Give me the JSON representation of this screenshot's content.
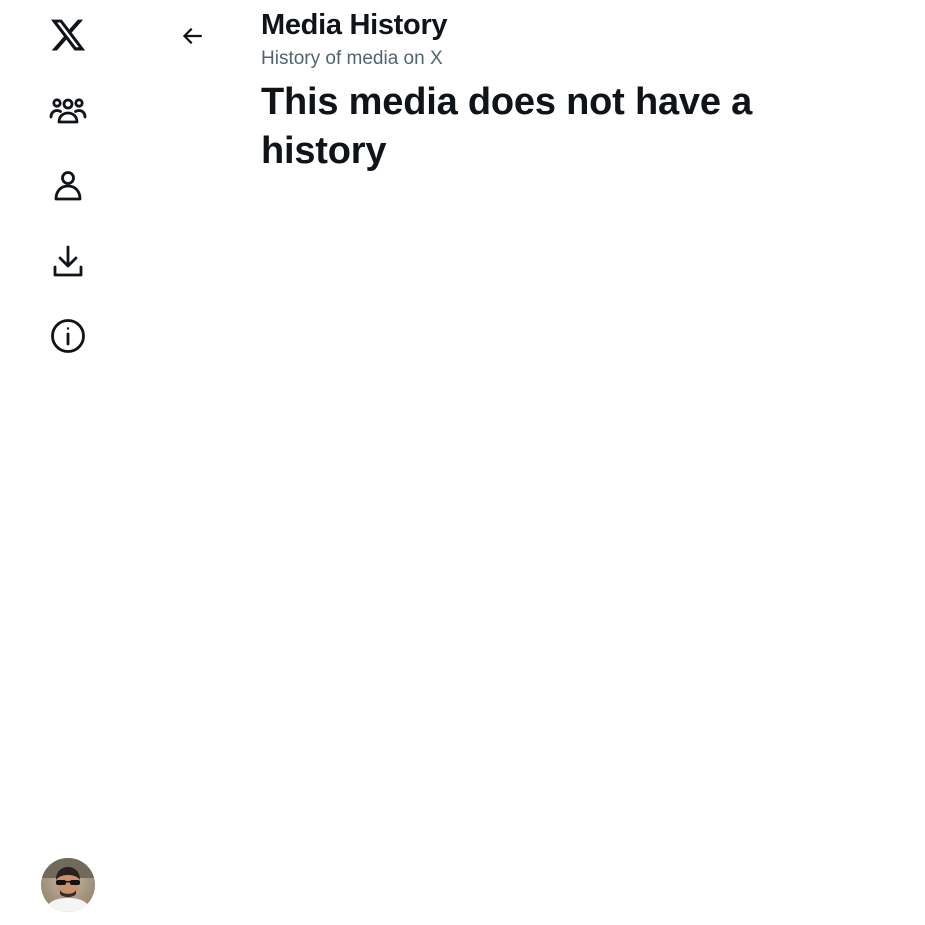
{
  "sidebar": {
    "items": [
      {
        "icon": "x-logo-icon",
        "label": "X"
      },
      {
        "icon": "communities-icon",
        "label": "Communities"
      },
      {
        "icon": "profile-icon",
        "label": "Profile"
      },
      {
        "icon": "download-icon",
        "label": "Download"
      },
      {
        "icon": "info-icon",
        "label": "Info"
      }
    ],
    "avatar": {
      "icon": "user-avatar"
    }
  },
  "header": {
    "back_icon": "arrow-left-icon",
    "title": "Media History",
    "subtitle": "History of media on X"
  },
  "main": {
    "empty_message": "This media does not have a history"
  },
  "colors": {
    "text": "#0f1419",
    "secondary_text": "#536471",
    "background": "#ffffff"
  }
}
